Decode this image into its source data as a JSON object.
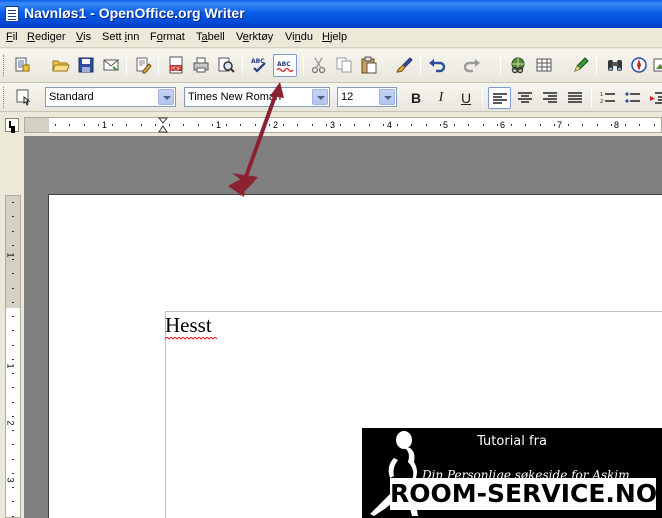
{
  "window": {
    "title": "Navnløs1 - OpenOffice.org Writer"
  },
  "menu": [
    {
      "pre": "",
      "u": "F",
      "post": "il"
    },
    {
      "pre": "",
      "u": "R",
      "post": "ediger"
    },
    {
      "pre": "",
      "u": "V",
      "post": "is"
    },
    {
      "pre": "Sett ",
      "u": "i",
      "post": "nn"
    },
    {
      "pre": "F",
      "u": "o",
      "post": "rmat"
    },
    {
      "pre": "T",
      "u": "a",
      "post": "bell"
    },
    {
      "pre": "V",
      "u": "e",
      "post": "rktøy"
    },
    {
      "pre": "Vi",
      "u": "n",
      "post": "du"
    },
    {
      "pre": "",
      "u": "H",
      "post": "jelp"
    }
  ],
  "formatting": {
    "style": "Standard",
    "font": "Times New Roman",
    "size": "12"
  },
  "ruler": {
    "h_numbers": [
      "1",
      "1",
      "2",
      "3",
      "4",
      "5",
      "6",
      "7",
      "8"
    ],
    "v_numbers": [
      "1",
      "1",
      "2",
      "3"
    ]
  },
  "document": {
    "text": "Hesst"
  },
  "banner": {
    "line1": "Tutorial fra",
    "line2": "Din Personlige søkeside for Askim",
    "brand": "ROOM-SERVICE.NO"
  },
  "colors": {
    "titlebar": "#0a5ee8",
    "arrow": "#8b2232",
    "spell_underline": "#e02020"
  },
  "icons": {
    "autospell_toggle": "autospellcheck-icon"
  }
}
